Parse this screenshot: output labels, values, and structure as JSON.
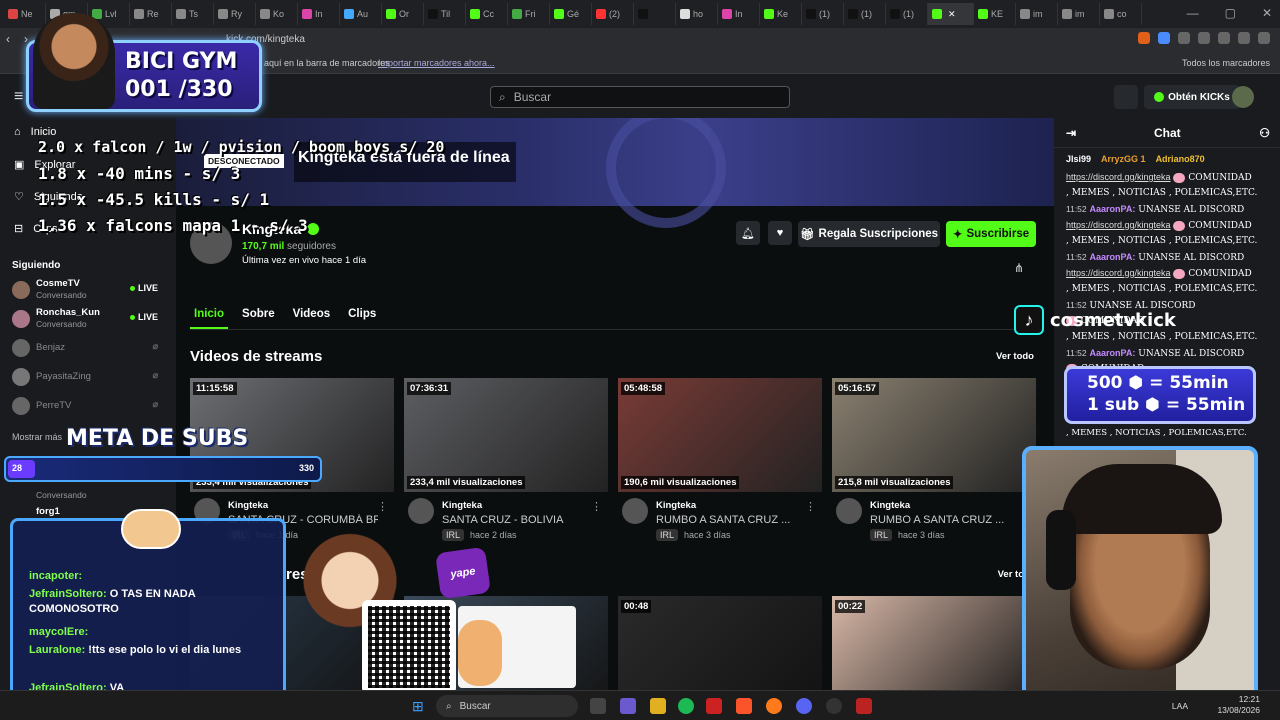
{
  "browser": {
    "tabs": [
      {
        "label": "Ne",
        "color": "#d44"
      },
      {
        "label": "gm",
        "color": "#aaa"
      },
      {
        "label": "Lvl",
        "color": "#4a4"
      },
      {
        "label": "Re",
        "color": "#888"
      },
      {
        "label": "Ts",
        "color": "#888"
      },
      {
        "label": "Ry",
        "color": "#888"
      },
      {
        "label": "Ko",
        "color": "#888"
      },
      {
        "label": "In",
        "color": "#d4a"
      },
      {
        "label": "Au",
        "color": "#4af"
      },
      {
        "label": "Or",
        "color": "#53fc18"
      },
      {
        "label": "Til",
        "color": "#111"
      },
      {
        "label": "Cc",
        "color": "#53fc18"
      },
      {
        "label": "Fri",
        "color": "#4a4"
      },
      {
        "label": "Gé",
        "color": "#53fc18"
      },
      {
        "label": "(2)",
        "color": "#f33"
      },
      {
        "label": "",
        "color": "#111"
      },
      {
        "label": "ho",
        "color": "#ddd"
      },
      {
        "label": "In",
        "color": "#d4a"
      },
      {
        "label": "Ke",
        "color": "#53fc18"
      },
      {
        "label": "(1)",
        "color": "#111"
      },
      {
        "label": "(1)",
        "color": "#111"
      },
      {
        "label": "(1)",
        "color": "#111"
      },
      {
        "label": "",
        "color": "#53fc18",
        "active": true
      },
      {
        "label": "KE",
        "color": "#53fc18"
      },
      {
        "label": "im",
        "color": "#888"
      },
      {
        "label": "im",
        "color": "#888"
      },
      {
        "label": "co",
        "color": "#888"
      }
    ],
    "url": "kick.com/kingteka",
    "bookmarks_text": "aquí en la barra de marcadores",
    "bookmarks_import": "Importar marcadores ahora...",
    "bookmarks_all": "Todos los marcadores"
  },
  "header": {
    "search_placeholder": "Buscar",
    "get_kicks": "Obtén KICKs"
  },
  "sidebar": {
    "nav": [
      {
        "label": "Inicio",
        "icon": "home-icon"
      },
      {
        "label": "Explorar",
        "icon": "compass-icon"
      },
      {
        "label": "Siguiendo",
        "icon": "heart-icon"
      },
      {
        "label": "Clips",
        "icon": "clips-icon"
      }
    ],
    "following_title": "Siguiendo",
    "following": [
      {
        "name": "CosmeTV",
        "sub": "Conversando",
        "live": true
      },
      {
        "name": "Ronchas_Kun",
        "sub": "Conversando",
        "live": true
      },
      {
        "name": "Benjaz",
        "live": false
      },
      {
        "name": "PayasitaZing",
        "live": false
      },
      {
        "name": "PerreTV",
        "live": false
      }
    ],
    "show_more": "Mostrar más",
    "partial_sub": "Conversando",
    "partial_name": "forg1"
  },
  "channel": {
    "offline_badge": "DESCONECTADO",
    "offline_text": "Kingteka está fuera de línea",
    "name": "Kingteka",
    "followers_count": "170,7 mil",
    "followers_label": "seguidores",
    "last_live": "Última vez en vivo hace 1 día",
    "gift_label": "Regala Suscripciones",
    "subscribe_label": "Suscribirse",
    "tabs": [
      "Inicio",
      "Sobre",
      "Videos",
      "Clips"
    ]
  },
  "streams": {
    "title": "Videos de streams",
    "see_all": "Ver todo",
    "items": [
      {
        "duration": "11:15:58",
        "views": "233,4 mil visualizaciones",
        "channel": "Kingteka",
        "title": "SANTA CRUZ - CORUMBÁ BR...",
        "tag": "IRL",
        "ago": "hace 1 día",
        "thumb": "#6d6f74"
      },
      {
        "duration": "07:36:31",
        "views": "233,4 mil visualizaciones",
        "channel": "Kingteka",
        "title": "SANTA CRUZ - BOLIVIA",
        "tag": "IRL",
        "ago": "hace 2 días",
        "thumb": "#5d5e62"
      },
      {
        "duration": "05:48:58",
        "views": "190,6 mil visualizaciones",
        "channel": "Kingteka",
        "title": "RUMBO A SANTA CRUZ ...",
        "tag": "IRL",
        "ago": "hace 3 días",
        "thumb": "#7a3b36"
      },
      {
        "duration": "05:16:57",
        "views": "215,8 mil visualizaciones",
        "channel": "Kingteka",
        "title": "RUMBO A SANTA CRUZ ...",
        "tag": "IRL",
        "ago": "hace 3 días",
        "thumb": "#8a8070"
      }
    ]
  },
  "clips": {
    "title_fragment": "res",
    "see_all_fragment": "Ver to",
    "items": [
      {
        "duration": "",
        "thumb": "#2a3a4a"
      },
      {
        "duration": "",
        "thumb": "#3a4a5a"
      },
      {
        "duration": "00:48",
        "thumb": "#2a2a2a"
      },
      {
        "duration": "00:22",
        "thumb": "#d8b8a8"
      }
    ]
  },
  "chat": {
    "title": "Chat",
    "top_badges": [
      "Jlsi99",
      "ArryzGG 1",
      "Adriano870"
    ],
    "lines": [
      {
        "time": "",
        "user": "",
        "text": "https://discord.gg/kingteka",
        "extra": "COMUNIDAD"
      },
      {
        "time": "",
        "user": "",
        "text": ", MEMES , NOTICIAS , POLEMICAS,ETC.",
        "extra": ""
      },
      {
        "time": "11:52",
        "user": "AaaronPA:",
        "text": "UNANSE AL DISCORD",
        "extra": ""
      },
      {
        "time": "",
        "user": "",
        "text": "https://discord.gg/kingteka",
        "extra": "COMUNIDAD"
      },
      {
        "time": "",
        "user": "",
        "text": ", MEMES , NOTICIAS , POLEMICAS,ETC.",
        "extra": ""
      },
      {
        "time": "11:52",
        "user": "AaaronPA:",
        "text": "UNANSE AL DISCORD",
        "extra": ""
      },
      {
        "time": "",
        "user": "",
        "text": "https://discord.gg/kingteka",
        "extra": "COMUNIDAD"
      },
      {
        "time": "",
        "user": "",
        "text": ", MEMES , NOTICIAS , POLEMICAS,ETC.",
        "extra": ""
      },
      {
        "time": "11:52",
        "user": "",
        "text": "UNANSE AL DISCORD",
        "extra": ""
      },
      {
        "time": "",
        "user": "",
        "text": "",
        "extra": "COMUNIDAD"
      },
      {
        "time": "",
        "user": "",
        "text": ", MEMES , NOTICIAS , POLEMICAS,ETC.",
        "extra": ""
      },
      {
        "time": "11:52",
        "user": "AaaronPA:",
        "text": "UNANSE AL DISCORD",
        "extra": ""
      },
      {
        "time": "",
        "user": "",
        "text": "",
        "extra": "COMUNIDAD"
      }
    ],
    "last_line": ", MEMES , NOTICIAS , POLEMICAS,ETC."
  },
  "overlays": {
    "gym_title": "BICI GYM",
    "gym_count": "001 /330",
    "rules": [
      "2.0 x  falcon / 1w / pvision / boom boys s/ 20",
      "1.8 x -40 mins - s/ 3",
      "1.5 x -45.5 kills - s/ 1",
      "1.36 x falcons mapa 1 - s/ 3"
    ],
    "meta_title": "META DE SUBS",
    "meta_current": 28,
    "meta_goal": 330,
    "meta_min_label": "28",
    "meta_max_label": "330",
    "chat_overlay": [
      {
        "name": "incapoter:",
        "text": ""
      },
      {
        "name": "JefrainSoltero:",
        "text": "O TAS EN NADA COMONOSOTRO"
      },
      {
        "name": "maycolEre:",
        "text": ""
      },
      {
        "name": "Lauralone:",
        "text": "!tts ese polo lo vi el dia lunes"
      },
      {
        "name": "JefrainSoltero:",
        "text": "VA"
      }
    ],
    "tiktok_name": "cosmetvkick",
    "kicks_line1": "500 ⬢ = 55min",
    "kicks_line2": "1 sub ⬢ = 55min",
    "yape": "yape"
  },
  "taskbar": {
    "search": "Buscar",
    "lang": "LAA",
    "time": "12:21",
    "date": "13/08/2026"
  },
  "colors": {
    "accent": "#53fc18",
    "chat_user": "#c58cff"
  }
}
